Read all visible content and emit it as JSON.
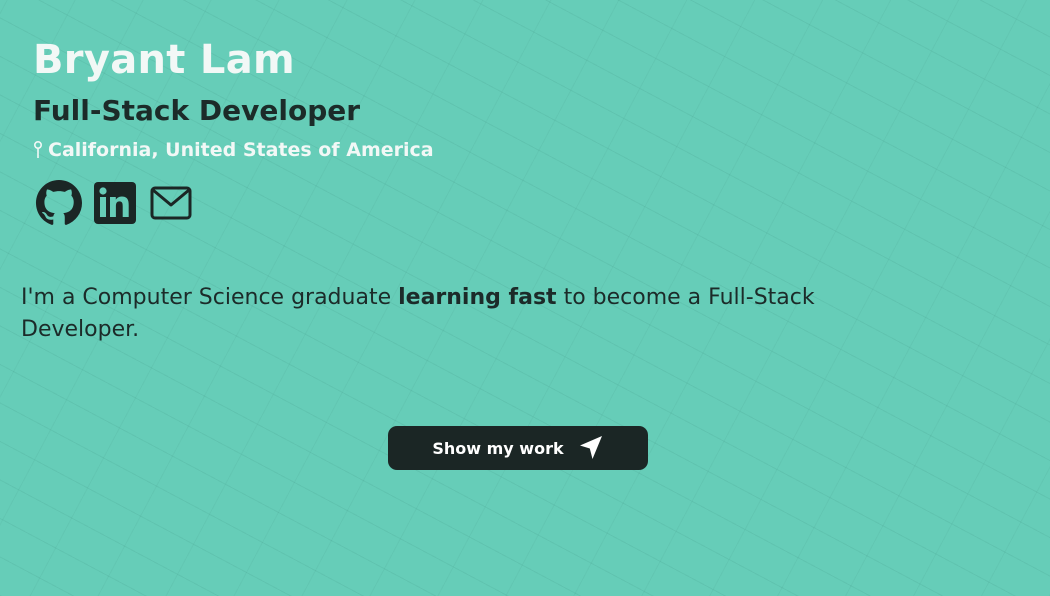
{
  "profile": {
    "name": "Bryant Lam",
    "title": "Full-Stack Developer",
    "location": "California, United States of America"
  },
  "social_links": [
    {
      "icon": "github-icon"
    },
    {
      "icon": "linkedin-icon"
    },
    {
      "icon": "mail-icon"
    }
  ],
  "bio": {
    "before": "I'm a Computer Science graduate ",
    "emphasis": "learning fast",
    "after": " to become a Full-Stack Developer."
  },
  "cta": {
    "label": "Show my work",
    "icon": "send-icon"
  },
  "colors": {
    "background": "#66cdb8",
    "name_text": "#f2f8f6",
    "dark_text": "#1c2b29",
    "button_bg": "#1b2625"
  }
}
